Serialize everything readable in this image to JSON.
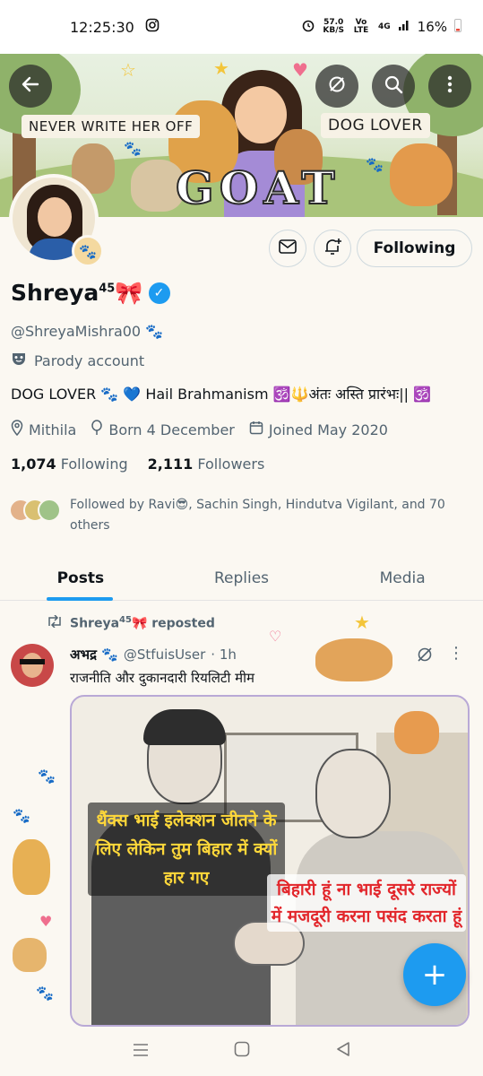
{
  "status_bar": {
    "time": "12:25:30",
    "speed_value": "57.0",
    "speed_unit": "KB/S",
    "network": "Vo LTE",
    "signal": "4G",
    "battery": "16%"
  },
  "banner": {
    "left_label": "NEVER WRITE HER OFF",
    "right_label": "DOG LOVER",
    "center_text": "GOAT"
  },
  "actions": {
    "following_label": "Following"
  },
  "profile": {
    "name": "Shreya",
    "name_sup": "45",
    "name_emoji": "🎀",
    "handle": "@ShreyaMishra00",
    "handle_emoji": "🐾",
    "parody_label": "Parody account",
    "bio": "DOG LOVER 🐾 💙 Hail Brahmanism 🕉️🔱अंतः अस्ति प्रारंभः|| 🕉️",
    "location": "Mithila",
    "birthday": "Born 4 December",
    "joined": "Joined May 2020",
    "following_count": "1,074",
    "following_label": "Following",
    "followers_count": "2,111",
    "followers_label": "Followers",
    "followed_by": "Followed by Ravi😎, Sachin Singh, Hindutva Vigilant, and 70 others"
  },
  "tabs": [
    {
      "label": "Posts",
      "active": true
    },
    {
      "label": "Replies",
      "active": false
    },
    {
      "label": "Media",
      "active": false
    }
  ],
  "post": {
    "repost_user": "Shreya",
    "repost_sup": "45",
    "repost_emoji": "🎀",
    "repost_label": "reposted",
    "author_name": "अभद्र",
    "author_emoji": "🐾",
    "author_handle": "@StfuisUser",
    "time": "· 1h",
    "text": "राजनीति और दुकानदारी रियलिटी मीम",
    "meme_caption_left": "थैंक्स भाई इलेक्शन जीतने के लिए लेकिन तुम बिहार में क्यों हार गए",
    "meme_caption_right": "बिहारी हूं ना भाई दूसरे राज्यों में मजदूरी करना पसंद करता हूं"
  },
  "colors": {
    "accent": "#1d9bf0",
    "background": "#fbf8f2",
    "text_secondary": "#536471"
  }
}
